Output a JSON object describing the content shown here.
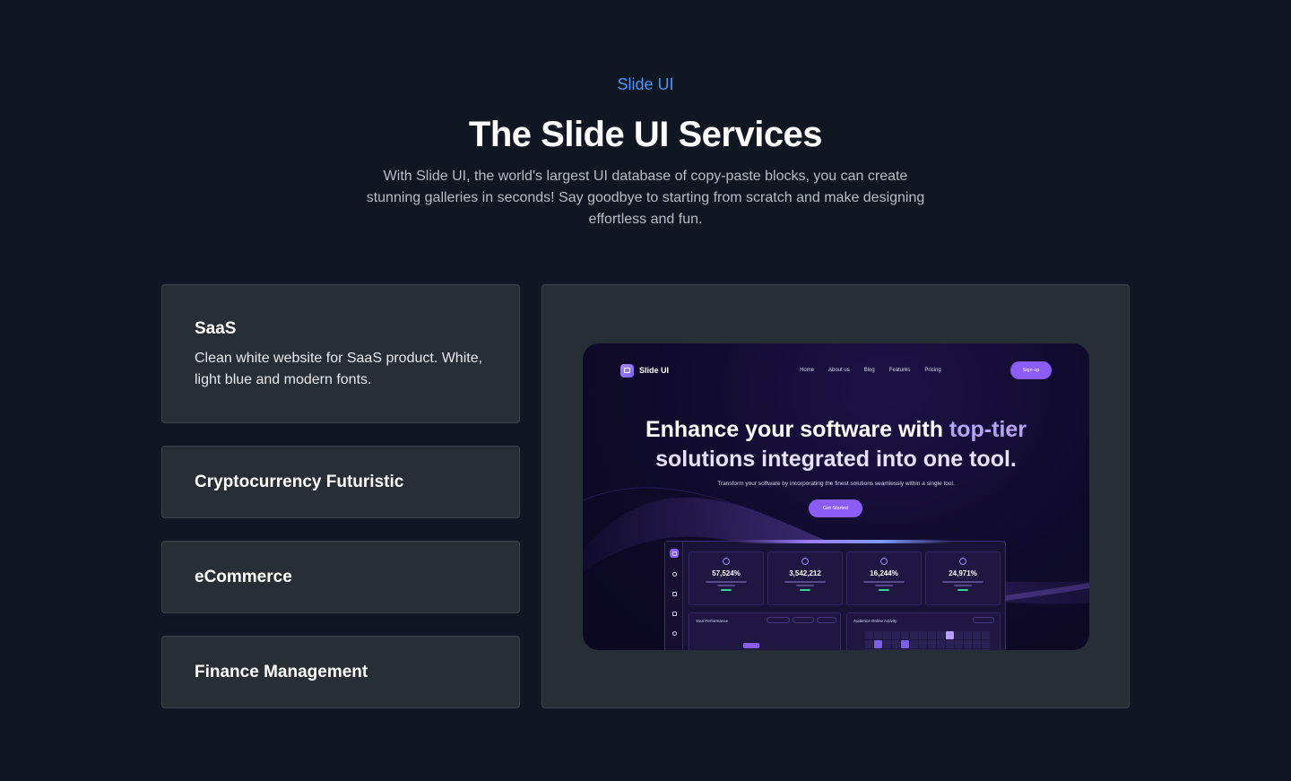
{
  "header": {
    "eyebrow": "Slide UI",
    "title": "The Slide UI Services",
    "subtitle": "With Slide UI, the world's largest UI database of copy-paste blocks, you can create stunning galleries in seconds! Say goodbye to starting from scratch and make designing effortless and fun."
  },
  "services": [
    {
      "title": "SaaS",
      "description": "Clean white website for SaaS product. White, light blue and modern fonts.",
      "expanded": true
    },
    {
      "title": "Cryptocurrency Futuristic",
      "expanded": false
    },
    {
      "title": "eCommerce",
      "expanded": false
    },
    {
      "title": "Finance Management",
      "expanded": false
    }
  ],
  "preview": {
    "logo": "Slide UI",
    "nav_links": [
      "Home",
      "About us",
      "Blog",
      "Features",
      "Pricing"
    ],
    "signup": "Sign up",
    "headline_part1": "Enhance your software with ",
    "headline_part2": "top-tier",
    "headline_part3": "solutions integrated into one tool.",
    "subline": "Transform your software by incorporating the finest solutions seamlessly within a single tool.",
    "cta": "Get Started",
    "stats": [
      "57,524%",
      "3,542,212",
      "16,244%",
      "24,971%"
    ],
    "panels": [
      "Your Performance",
      "Audience Online Activity"
    ]
  },
  "colors": {
    "background": "#111722",
    "card": "#272e35",
    "eyebrow": "#4c95f2",
    "accent": "#8b5cf6"
  }
}
